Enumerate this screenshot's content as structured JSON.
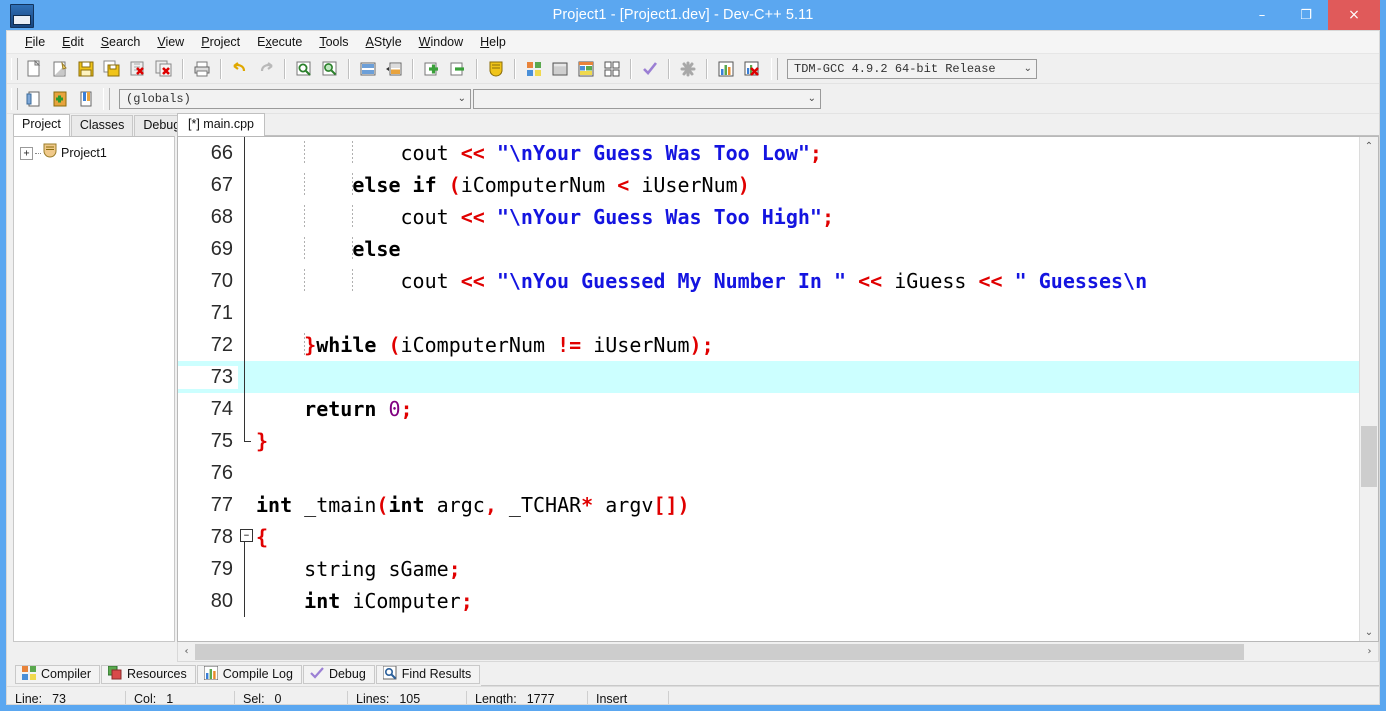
{
  "window": {
    "title": "Project1 - [Project1.dev] - Dev-C++ 5.11",
    "icon": "devcpp-app-icon",
    "controls": {
      "minimize": "–",
      "maximize": "❐",
      "close": "×"
    },
    "accent_color": "#5ba7f0",
    "close_color": "#e05a5a"
  },
  "menu": [
    {
      "label": "File",
      "pre": "",
      "hot": "F",
      "post": "ile"
    },
    {
      "label": "Edit",
      "pre": "",
      "hot": "E",
      "post": "dit"
    },
    {
      "label": "Search",
      "pre": "",
      "hot": "S",
      "post": "earch"
    },
    {
      "label": "View",
      "pre": "",
      "hot": "V",
      "post": "iew"
    },
    {
      "label": "Project",
      "pre": "",
      "hot": "P",
      "post": "roject"
    },
    {
      "label": "Execute",
      "pre": "E",
      "hot": "x",
      "post": "ecute"
    },
    {
      "label": "Tools",
      "pre": "",
      "hot": "T",
      "post": "ools"
    },
    {
      "label": "AStyle",
      "pre": "",
      "hot": "A",
      "post": "Style"
    },
    {
      "label": "Window",
      "pre": "",
      "hot": "W",
      "post": "indow"
    },
    {
      "label": "Help",
      "pre": "",
      "hot": "H",
      "post": "elp"
    }
  ],
  "toolbar1": [
    "new-file-icon",
    "open-file-icon",
    "save-file-icon",
    "save-all-icon",
    "close-file-icon",
    "close-all-icon",
    "print-icon",
    "undo-icon",
    "redo-icon",
    "find-icon",
    "replace-icon",
    "goto-line-icon",
    "goto-function-icon",
    "add-to-project-icon",
    "remove-from-project-icon",
    "project-options-icon",
    "compile-icon",
    "run-icon",
    "compile-and-run-icon",
    "rebuild-all-icon",
    "syntax-check-icon",
    "stop-execution-icon",
    "profile-icon",
    "delete-profile-icon"
  ],
  "compiler_combo": {
    "name": "compiler-set-combo",
    "value": "TDM-GCC 4.9.2 64-bit Release",
    "arrow": "⌄"
  },
  "toolbar2": [
    "goto-class-browser-icon",
    "insert-icon",
    "toggle-bookmark-icon"
  ],
  "scope_combo": {
    "name": "scope-combo",
    "value": "(globals)",
    "arrow": "⌄"
  },
  "member_combo": {
    "name": "member-combo",
    "value": "",
    "arrow": "⌄"
  },
  "left_panel": {
    "tabs": [
      {
        "label": "Project",
        "active": true
      },
      {
        "label": "Classes",
        "active": false
      },
      {
        "label": "Debug",
        "active": false
      }
    ],
    "tree": {
      "expander": "+",
      "icon": "project-folder-icon",
      "label": "Project1"
    }
  },
  "editor": {
    "tabs": [
      {
        "label": "[*] main.cpp",
        "active": true
      }
    ],
    "current_line": 73,
    "highlight_color": "#ccffff",
    "lines": [
      {
        "n": 66,
        "fold": "line",
        "indent_guides": [
          1,
          2
        ],
        "tokens": [
          {
            "t": "            cout ",
            "c": "pl"
          },
          {
            "t": "<<",
            "c": "op"
          },
          {
            "t": " ",
            "c": "pl"
          },
          {
            "t": "\"\\nYour Guess Was Too Low\"",
            "c": "str"
          },
          {
            "t": ";",
            "c": "op"
          }
        ]
      },
      {
        "n": 67,
        "fold": "line",
        "indent_guides": [
          1,
          2
        ],
        "tokens": [
          {
            "t": "        ",
            "c": "pl"
          },
          {
            "t": "else if",
            "c": "kw"
          },
          {
            "t": " ",
            "c": "pl"
          },
          {
            "t": "(",
            "c": "op"
          },
          {
            "t": "iComputerNum ",
            "c": "pl"
          },
          {
            "t": "<",
            "c": "op"
          },
          {
            "t": " iUserNum",
            "c": "pl"
          },
          {
            "t": ")",
            "c": "op"
          }
        ]
      },
      {
        "n": 68,
        "fold": "line",
        "indent_guides": [
          1,
          2
        ],
        "tokens": [
          {
            "t": "            cout ",
            "c": "pl"
          },
          {
            "t": "<<",
            "c": "op"
          },
          {
            "t": " ",
            "c": "pl"
          },
          {
            "t": "\"\\nYour Guess Was Too High\"",
            "c": "str"
          },
          {
            "t": ";",
            "c": "op"
          }
        ]
      },
      {
        "n": 69,
        "fold": "line",
        "indent_guides": [
          1,
          2
        ],
        "tokens": [
          {
            "t": "        ",
            "c": "pl"
          },
          {
            "t": "else",
            "c": "kw"
          }
        ]
      },
      {
        "n": 70,
        "fold": "line",
        "indent_guides": [
          1,
          2
        ],
        "tokens": [
          {
            "t": "            cout ",
            "c": "pl"
          },
          {
            "t": "<<",
            "c": "op"
          },
          {
            "t": " ",
            "c": "pl"
          },
          {
            "t": "\"\\nYou Guessed My Number In \"",
            "c": "str"
          },
          {
            "t": " ",
            "c": "pl"
          },
          {
            "t": "<<",
            "c": "op"
          },
          {
            "t": " iGuess ",
            "c": "pl"
          },
          {
            "t": "<<",
            "c": "op"
          },
          {
            "t": " ",
            "c": "pl"
          },
          {
            "t": "\" Guesses\\n",
            "c": "str"
          }
        ]
      },
      {
        "n": 71,
        "fold": "line",
        "indent_guides": [
          1,
          2
        ],
        "tokens": []
      },
      {
        "n": 72,
        "fold": "line",
        "indent_guides": [
          1
        ],
        "tokens": [
          {
            "t": "    ",
            "c": "pl"
          },
          {
            "t": "}",
            "c": "op"
          },
          {
            "t": "while",
            "c": "kw"
          },
          {
            "t": " ",
            "c": "pl"
          },
          {
            "t": "(",
            "c": "op"
          },
          {
            "t": "iComputerNum ",
            "c": "pl"
          },
          {
            "t": "!=",
            "c": "op"
          },
          {
            "t": " iUserNum",
            "c": "pl"
          },
          {
            "t": ")",
            "c": "op"
          },
          {
            "t": ";",
            "c": "op"
          }
        ]
      },
      {
        "n": 73,
        "fold": "line",
        "indent_guides": [],
        "highlight": true,
        "caret": true,
        "tokens": []
      },
      {
        "n": 74,
        "fold": "line",
        "indent_guides": [],
        "tokens": [
          {
            "t": "    ",
            "c": "pl"
          },
          {
            "t": "return",
            "c": "kw"
          },
          {
            "t": " ",
            "c": "pl"
          },
          {
            "t": "0",
            "c": "num"
          },
          {
            "t": ";",
            "c": "op"
          }
        ]
      },
      {
        "n": 75,
        "fold": "end",
        "indent_guides": [],
        "tokens": [
          {
            "t": "}",
            "c": "op"
          }
        ]
      },
      {
        "n": 76,
        "fold": "none",
        "indent_guides": [],
        "tokens": []
      },
      {
        "n": 77,
        "fold": "none",
        "indent_guides": [],
        "tokens": [
          {
            "t": "int",
            "c": "kw"
          },
          {
            "t": " _tmain",
            "c": "pl"
          },
          {
            "t": "(",
            "c": "op"
          },
          {
            "t": "int",
            "c": "kw"
          },
          {
            "t": " argc",
            "c": "pl"
          },
          {
            "t": ",",
            "c": "op"
          },
          {
            "t": " _TCHAR",
            "c": "pl"
          },
          {
            "t": "*",
            "c": "op"
          },
          {
            "t": " argv",
            "c": "pl"
          },
          {
            "t": "[]",
            "c": "op"
          },
          {
            "t": ")",
            "c": "op"
          }
        ]
      },
      {
        "n": 78,
        "fold": "start",
        "indent_guides": [],
        "tokens": [
          {
            "t": "{",
            "c": "op"
          }
        ]
      },
      {
        "n": 79,
        "fold": "line",
        "indent_guides": [],
        "tokens": [
          {
            "t": "    string sGame",
            "c": "pl"
          },
          {
            "t": ";",
            "c": "op"
          }
        ]
      },
      {
        "n": 80,
        "fold": "line",
        "indent_guides": [],
        "tokens": [
          {
            "t": "    ",
            "c": "pl"
          },
          {
            "t": "int",
            "c": "kw"
          },
          {
            "t": " iComputer",
            "c": "pl"
          },
          {
            "t": ";",
            "c": "op"
          }
        ]
      }
    ],
    "vscroll": {
      "up": "⌃",
      "down": "⌄",
      "thumb_top_pct": 58,
      "thumb_height_pct": 13
    },
    "hscroll": {
      "left": "‹",
      "right": "›",
      "thumb_left_pct": 0,
      "thumb_width_pct": 90
    }
  },
  "bottom_tabs": [
    {
      "label": "Compiler",
      "icon": "compiler-icon"
    },
    {
      "label": "Resources",
      "icon": "resources-icon"
    },
    {
      "label": "Compile Log",
      "icon": "compile-log-icon"
    },
    {
      "label": "Debug",
      "icon": "debug-check-icon"
    },
    {
      "label": "Find Results",
      "icon": "find-results-icon"
    }
  ],
  "statusbar": [
    {
      "label": "Line:",
      "value": "73"
    },
    {
      "label": "Col:",
      "value": "1"
    },
    {
      "label": "Sel:",
      "value": "0"
    },
    {
      "label": "Lines:",
      "value": "105"
    },
    {
      "label": "Length:",
      "value": "1777"
    },
    {
      "label": "Insert",
      "value": ""
    }
  ]
}
